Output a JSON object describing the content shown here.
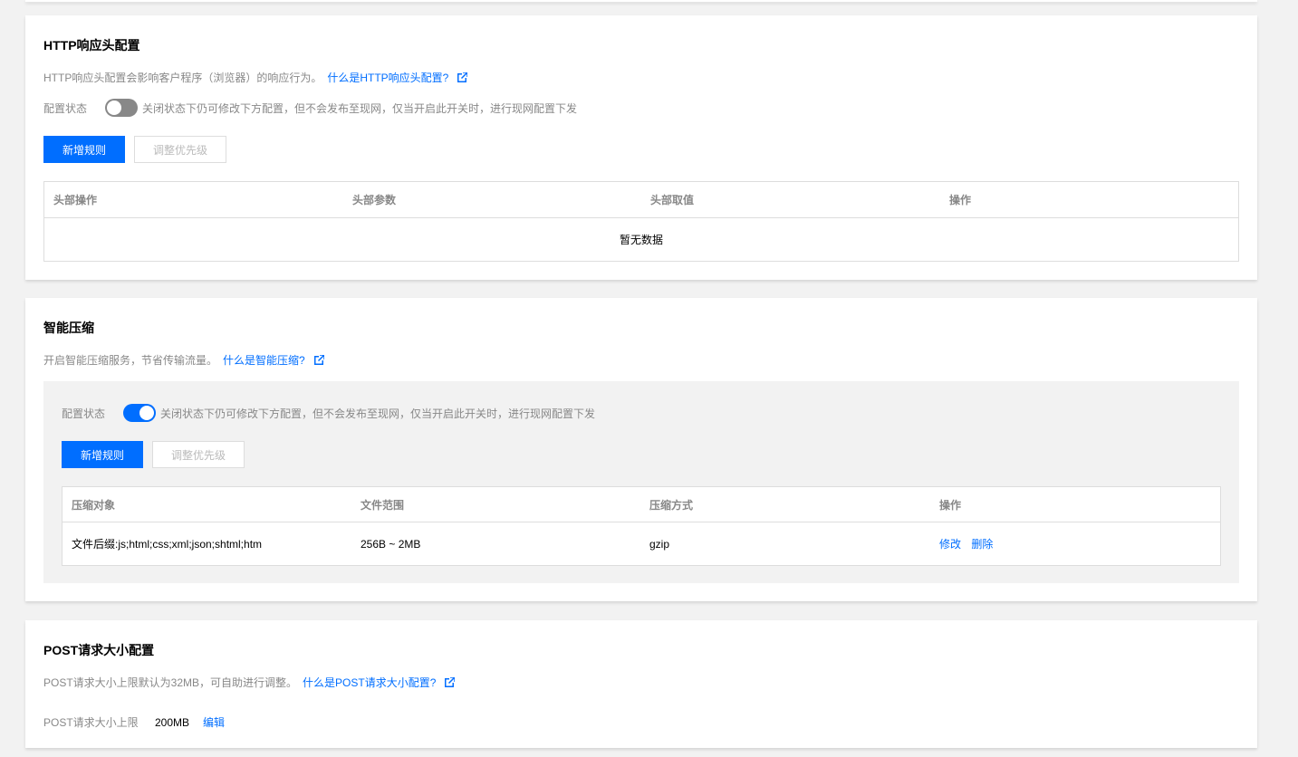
{
  "http_header": {
    "title": "HTTP响应头配置",
    "desc": "HTTP响应头配置会影响客户程序（浏览器）的响应行为。",
    "help_link": "什么是HTTP响应头配置?",
    "status_label": "配置状态",
    "toggle_on": false,
    "status_hint": "关闭状态下仍可修改下方配置，但不会发布至现网，仅当开启此开关时，进行现网配置下发",
    "add_rule": "新增规则",
    "adjust_priority": "调整优先级",
    "columns": [
      "头部操作",
      "头部参数",
      "头部取值",
      "操作"
    ],
    "empty_text": "暂无数据"
  },
  "compression": {
    "title": "智能压缩",
    "desc": "开启智能压缩服务，节省传输流量。",
    "help_link": "什么是智能压缩?",
    "status_label": "配置状态",
    "toggle_on": true,
    "status_hint": "关闭状态下仍可修改下方配置，但不会发布至现网，仅当开启此开关时，进行现网配置下发",
    "add_rule": "新增规则",
    "adjust_priority": "调整优先级",
    "columns": [
      "压缩对象",
      "文件范围",
      "压缩方式",
      "操作"
    ],
    "rows": [
      {
        "target": "文件后缀:js;html;css;xml;json;shtml;htm",
        "range": "256B ~ 2MB",
        "method": "gzip",
        "edit": "修改",
        "delete": "删除"
      }
    ]
  },
  "post_size": {
    "title": "POST请求大小配置",
    "desc": "POST请求大小上限默认为32MB，可自助进行调整。",
    "help_link": "什么是POST请求大小配置?",
    "limit_label": "POST请求大小上限",
    "limit_value": "200MB",
    "edit": "编辑"
  },
  "colors": {
    "accent": "#006eff",
    "toggle_off": "#888888",
    "page_bg": "#f2f2f2"
  }
}
